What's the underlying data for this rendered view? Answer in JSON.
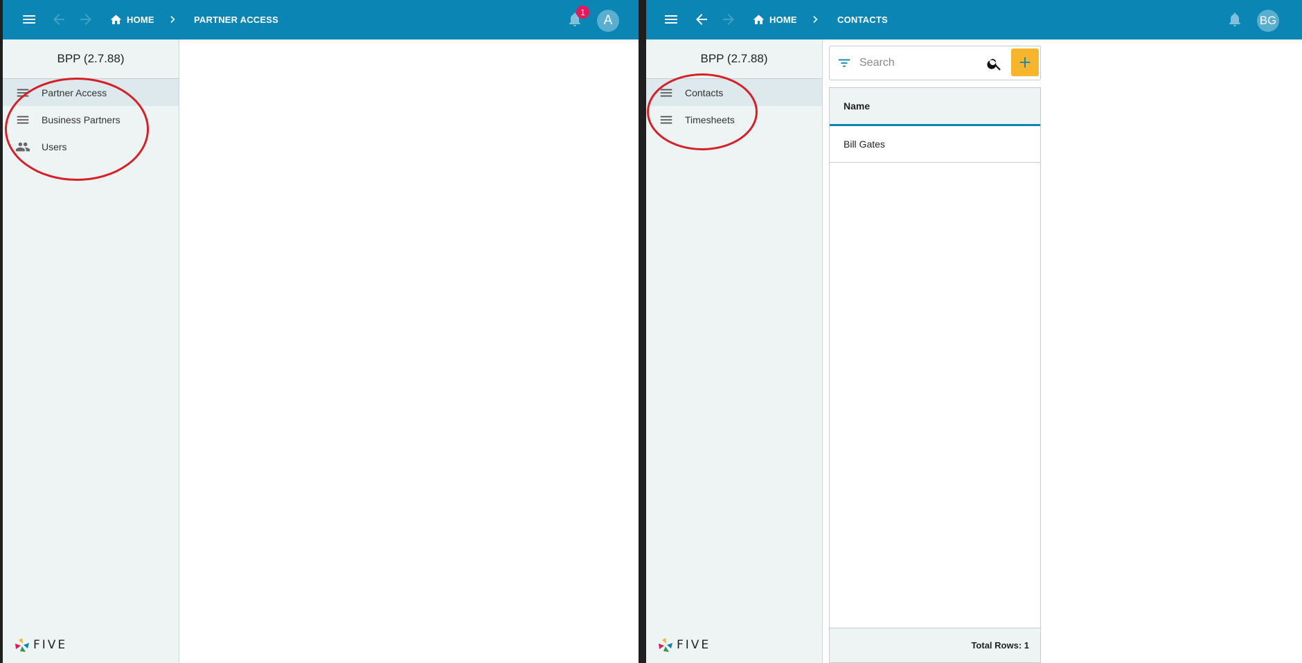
{
  "left_window": {
    "breadcrumb": {
      "home": "HOME",
      "current": "PARTNER ACCESS"
    },
    "notifications": {
      "count": "1"
    },
    "avatar": "A",
    "app_title": "BPP (2.7.88)",
    "menu": [
      {
        "label": "Partner Access",
        "icon": "menu-lines-icon",
        "active": true
      },
      {
        "label": "Business Partners",
        "icon": "menu-lines-icon",
        "active": false
      },
      {
        "label": "Users",
        "icon": "people-icon",
        "active": false
      }
    ],
    "logo": "FIVE"
  },
  "right_window": {
    "breadcrumb": {
      "home": "HOME",
      "current": "CONTACTS"
    },
    "avatar": "BG",
    "app_title": "BPP (2.7.88)",
    "menu": [
      {
        "label": "Contacts",
        "icon": "menu-lines-icon",
        "active": true
      },
      {
        "label": "Timesheets",
        "icon": "menu-lines-icon",
        "active": false
      }
    ],
    "search": {
      "placeholder": "Search",
      "value": ""
    },
    "list": {
      "header": "Name",
      "rows": [
        "Bill Gates"
      ],
      "footer": "Total Rows: 1"
    },
    "logo": "FIVE"
  },
  "colors": {
    "topbar": "#0a85b4",
    "sidebar": "#eef3f3",
    "add_button": "#f6b52c",
    "badge": "#e5195b",
    "annotation_ring": "#d71f27"
  }
}
